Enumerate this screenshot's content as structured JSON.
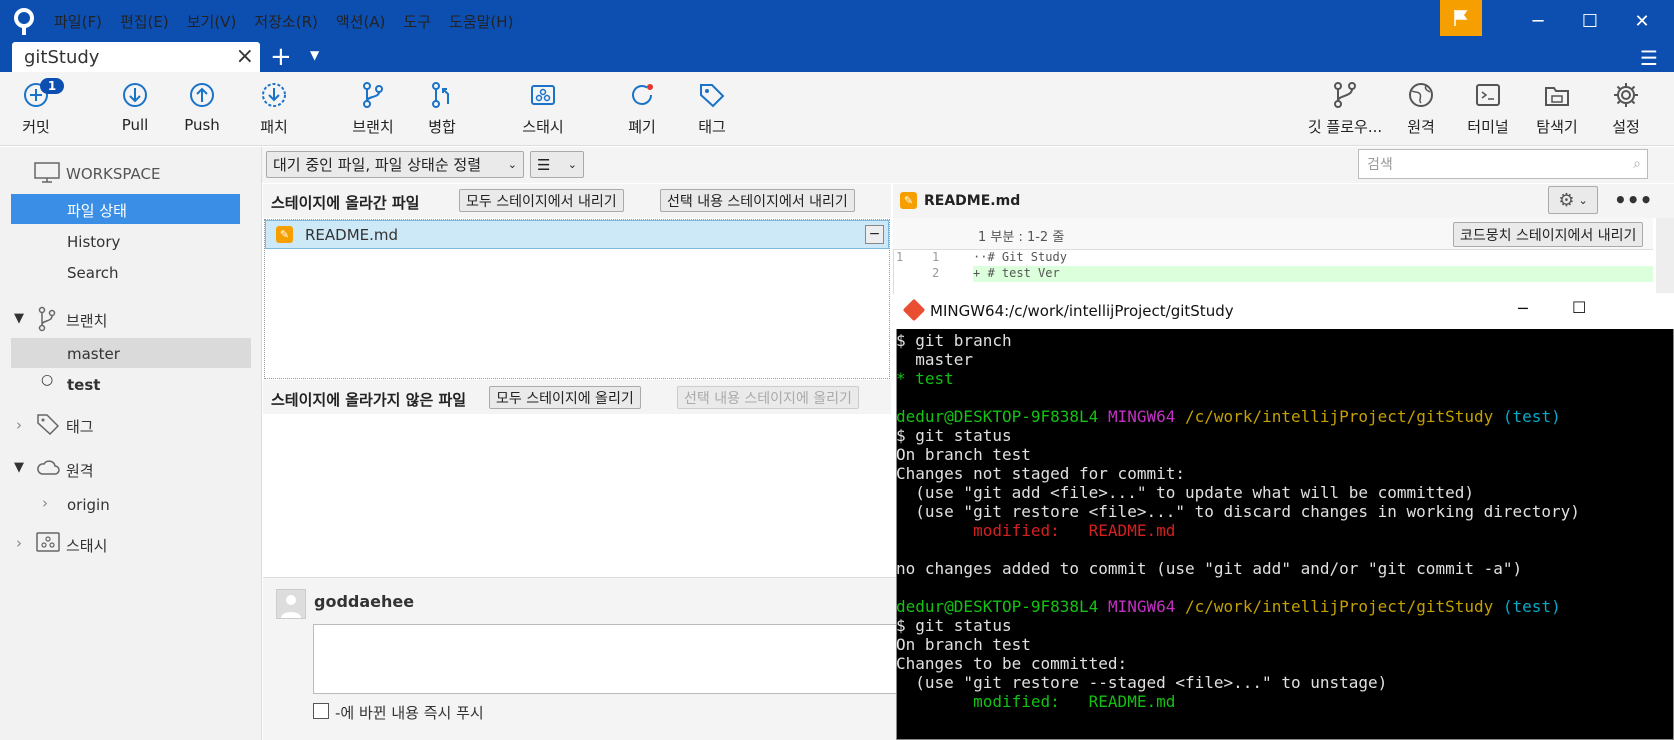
{
  "window": {
    "menu": [
      "파일(F)",
      "편집(E)",
      "보기(V)",
      "저장소(R)",
      "액션(A)",
      "도구",
      "도움말(H)"
    ],
    "tab_title": "gitStudy",
    "flag_color": "#f5a000"
  },
  "toolbar": {
    "commit": "커밋",
    "commit_badge": "1",
    "pull": "Pull",
    "push": "Push",
    "patch": "패치",
    "branch": "브랜치",
    "merge": "병합",
    "stash": "스태시",
    "discard": "폐기",
    "tag": "태그",
    "gitflow": "깃 플로우...",
    "remote": "원격",
    "terminal": "터미널",
    "explorer": "탐색기",
    "settings": "설정"
  },
  "sidebar": {
    "workspace": "WORKSPACE",
    "file_status": "파일 상태",
    "history": "History",
    "search": "Search",
    "branches": "브랜치",
    "branch_items": [
      "master",
      "test"
    ],
    "tags": "태그",
    "remotes": "원격",
    "remote_items": [
      "origin"
    ],
    "stashes": "스태시"
  },
  "filters": {
    "sort": "대기 중인 파일, 파일 상태순 정렬",
    "view": "☰",
    "search_placeholder": "검색"
  },
  "staged": {
    "title": "스테이지에 올라간 파일",
    "unstage_all": "모두 스테이지에서 내리기",
    "unstage_selected": "선택 내용 스테이지에서 내리기",
    "files": [
      "README.md"
    ]
  },
  "unstaged": {
    "title": "스테이지에 올라가지 않은 파일",
    "stage_all": "모두 스테이지에 올리기",
    "stage_selected": "선택 내용 스테이지에 올리기"
  },
  "commit": {
    "author": "goddaehee",
    "push_checkbox": "-에 바뀐 내용 즉시 푸시"
  },
  "diff": {
    "filename": "README.md",
    "hunk": "1 부분 : 1-2 줄",
    "unstage_hunk": "코드뭉치 스테이지에서 내리기",
    "lines": [
      {
        "old": "1",
        "new": "1",
        "text": "··# Git Study"
      },
      {
        "old": "",
        "new": "2",
        "text": "+ # test Ver"
      }
    ]
  },
  "terminal": {
    "title": "MINGW64:/c/work/intellijProject/gitStudy",
    "prompt_user": "dedur@DESKTOP-9F838L4",
    "prompt_env": "MINGW64",
    "prompt_path": "/c/work/intellijProject/gitStudy",
    "prompt_branch": "(test)",
    "l1": "$ git branch",
    "l2": "  master",
    "l3": "* test",
    "l5": "$ git status",
    "l6": "On branch test",
    "l7": "Changes not staged for commit:",
    "l8": "  (use \"git add <file>...\" to update what will be committed)",
    "l9": "  (use \"git restore <file>...\" to discard changes in working directory)",
    "l10": "        modified:   README.md",
    "l12": "no changes added to commit (use \"git add\" and/or \"git commit -a\")",
    "l14": "$ git status",
    "l15": "On branch test",
    "l16": "Changes to be committed:",
    "l17": "  (use \"git restore --staged <file>...\" to unstage)",
    "l18": "        modified:   README.md"
  }
}
